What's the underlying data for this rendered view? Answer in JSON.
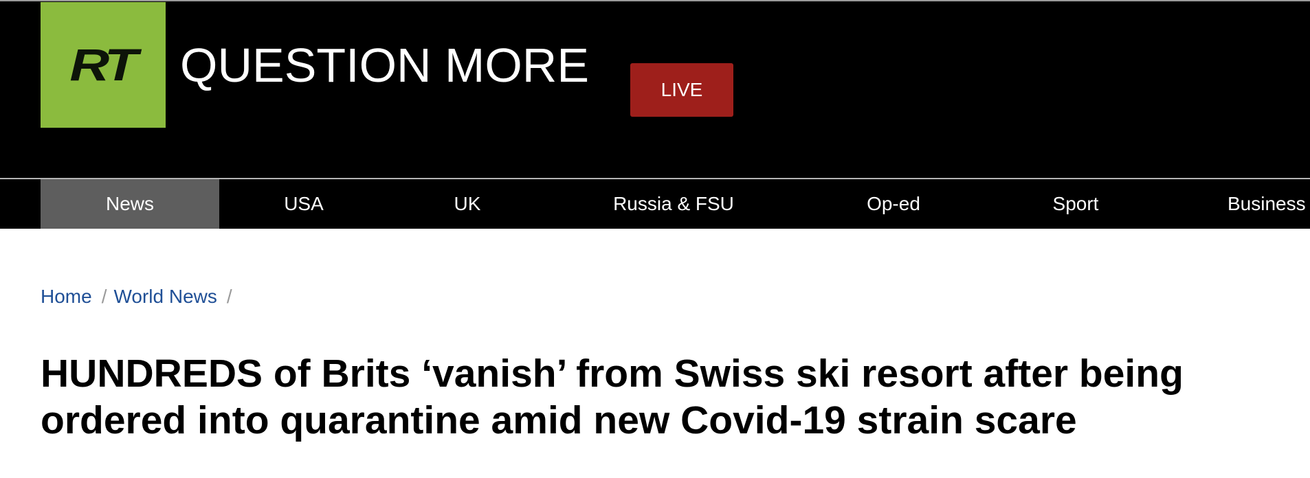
{
  "brand": {
    "logo_text": "RT",
    "tagline": "QUESTION MORE",
    "logo_color": "#8bbb3e"
  },
  "live_button": {
    "label": "LIVE",
    "color": "#9e1f1b"
  },
  "nav": {
    "items": [
      {
        "label": "News",
        "active": true
      },
      {
        "label": "USA"
      },
      {
        "label": "UK"
      },
      {
        "label": "Russia & FSU"
      },
      {
        "label": "Op-ed"
      },
      {
        "label": "Sport"
      },
      {
        "label": "Business"
      }
    ]
  },
  "breadcrumb": {
    "items": [
      "Home",
      "World News"
    ],
    "separator": "/"
  },
  "article": {
    "headline": "HUNDREDS of Brits ‘vanish’ from Swiss ski resort after being ordered into quarantine amid new Covid-19 strain scare"
  }
}
